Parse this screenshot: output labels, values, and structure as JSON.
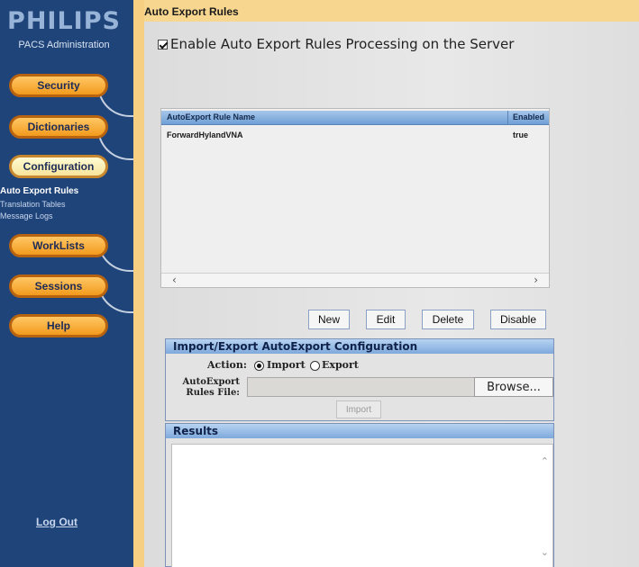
{
  "brand": {
    "logo": "PHILIPS",
    "subtitle": "PACS Administration"
  },
  "sidebar": {
    "nav": [
      {
        "label": "Security"
      },
      {
        "label": "Dictionaries"
      },
      {
        "label": "Configuration"
      },
      {
        "label": "WorkLists"
      },
      {
        "label": "Sessions"
      },
      {
        "label": "Help"
      }
    ],
    "config_links": [
      "Auto Export Rules",
      "Translation Tables",
      "Message Logs"
    ],
    "logout": "Log Out"
  },
  "page": {
    "title": "Auto Export Rules",
    "enable_label": "Enable Auto Export Rules Processing on the Server"
  },
  "rules_table": {
    "columns": [
      "AutoExport Rule Name",
      "Enabled"
    ],
    "rows": [
      [
        "ForwardHylandVNA",
        "true"
      ]
    ]
  },
  "actions": {
    "new": "New",
    "edit": "Edit",
    "delete": "Delete",
    "disable": "Disable"
  },
  "import_export": {
    "title": "Import/Export AutoExport Configuration",
    "action_label": "Action:",
    "option_import": "Import",
    "option_export": "Export",
    "selected": "Import",
    "file_label": "AutoExport Rules File:",
    "browse": "Browse...",
    "import_button": "Import"
  },
  "results": {
    "title": "Results"
  }
}
